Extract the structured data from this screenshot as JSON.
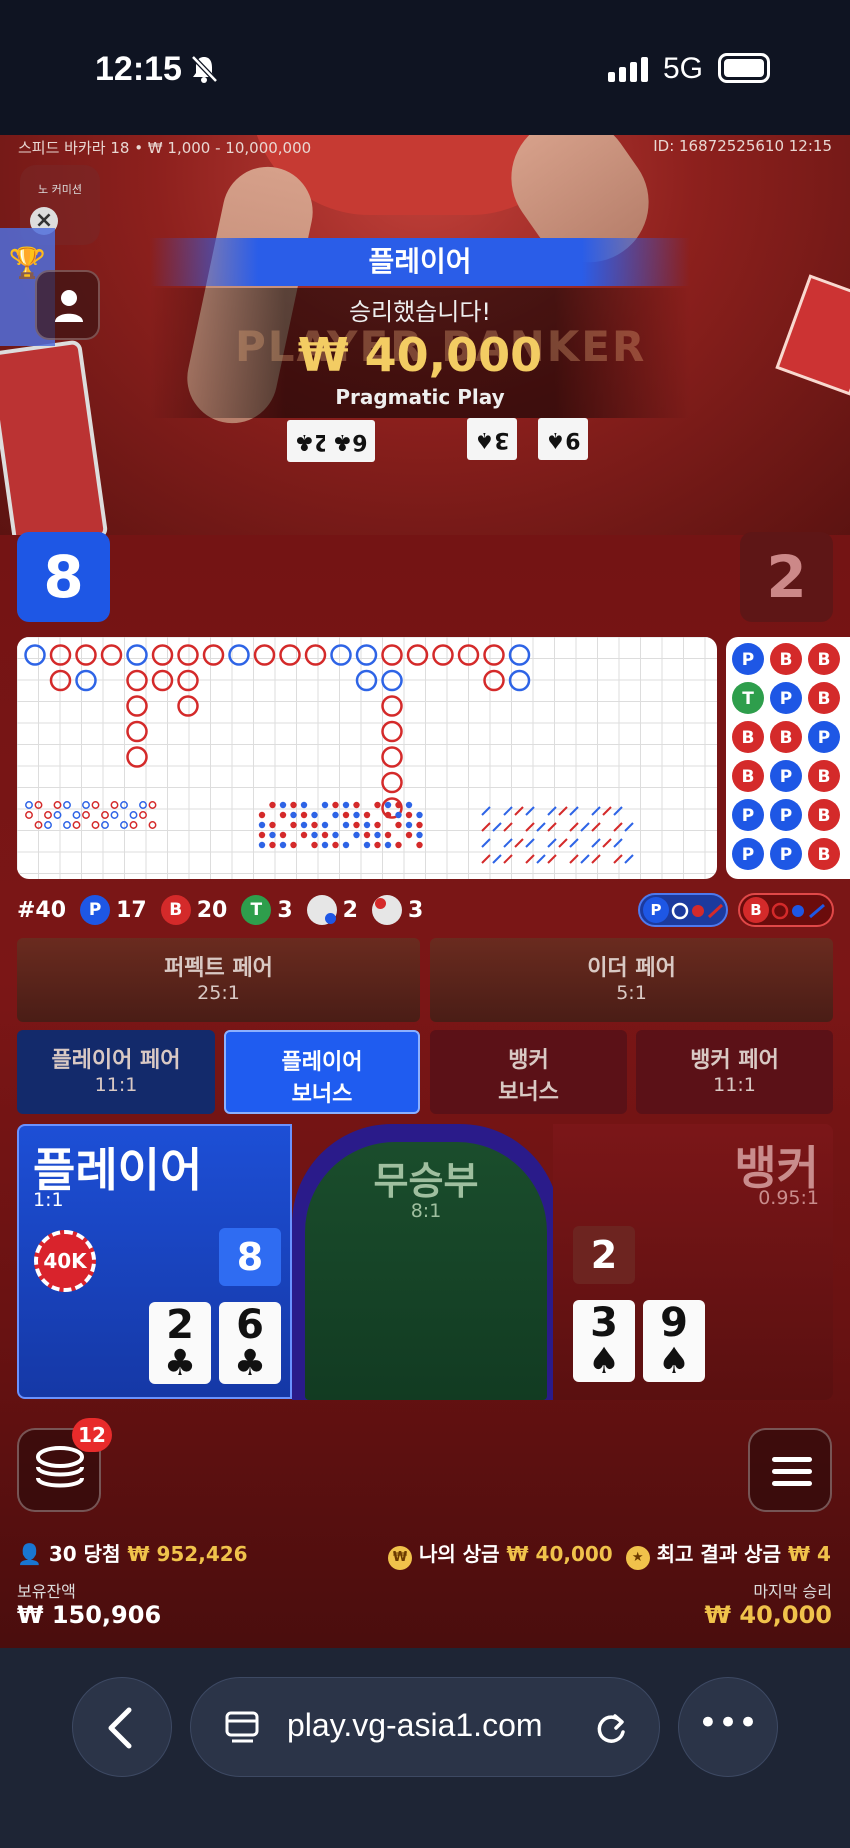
{
  "status": {
    "time": "12:15",
    "network": "5G"
  },
  "table_info": {
    "left": "스피드 바카라 18 • ₩ 1,000 - 10,000,000",
    "right": "ID: 16872525610 12:15",
    "no_commission": "노 커미션"
  },
  "result": {
    "winner": "플레이어",
    "message": "승리했습니다!",
    "amount": "₩ 40,000",
    "provider": "Pragmatic Play",
    "table_print": "PLAYER BANKER"
  },
  "scores": {
    "player": "8",
    "banker": "2"
  },
  "stats": {
    "shoe": "#40",
    "p_label": "P",
    "p_count": "17",
    "b_label": "B",
    "b_count": "20",
    "t_label": "T",
    "t_count": "3",
    "ppair_count": "2",
    "bpair_count": "3",
    "predict_p": "P",
    "predict_b": "B"
  },
  "bets": {
    "perfect_pair": {
      "name": "퍼펙트 페어",
      "odds": "25:1"
    },
    "either_pair": {
      "name": "이더 페어",
      "odds": "5:1"
    },
    "player_pair": {
      "name": "플레이어 페어",
      "odds": "11:1"
    },
    "player_bonus": {
      "line1": "플레이어",
      "line2": "보너스"
    },
    "banker_bonus": {
      "line1": "뱅커",
      "line2": "보너스"
    },
    "banker_pair": {
      "name": "뱅커 페어",
      "odds": "11:1"
    },
    "player": {
      "name": "플레이어",
      "odds": "1:1",
      "chip": "40K",
      "score": "8",
      "cards": [
        {
          "v": "2",
          "s": "♣"
        },
        {
          "v": "6",
          "s": "♣"
        }
      ]
    },
    "tie": {
      "name": "무승부",
      "odds": "8:1"
    },
    "banker": {
      "name": "뱅커",
      "odds": "0.95:1",
      "score": "2",
      "cards": [
        {
          "v": "3",
          "s": "♠"
        },
        {
          "v": "9",
          "s": "♠"
        }
      ]
    }
  },
  "table_cards": {
    "player": [
      {
        "v": "2",
        "s": "♣"
      },
      {
        "v": "6",
        "s": "♣"
      }
    ],
    "banker": [
      {
        "v": "3",
        "s": "♠"
      },
      {
        "v": "9",
        "s": "♠"
      }
    ]
  },
  "footer": {
    "chip_badge": "12",
    "winners_count": "30 당첨",
    "winners_amount": "₩ 952,426",
    "my_win_label": "나의 상금",
    "my_win_amount": "₩ 40,000",
    "best_label": "최고 결과 상금",
    "best_amount": "₩ 4",
    "balance_label": "보유잔액",
    "balance": "₩ 150,906",
    "last_win_label": "마지막 승리",
    "last_win": "₩ 40,000"
  },
  "browser": {
    "url": "play.vg-asia1.com"
  },
  "bead_road": [
    [
      "P",
      "B",
      "B"
    ],
    [
      "T",
      "P",
      "B"
    ],
    [
      "B",
      "B",
      "P"
    ],
    [
      "B",
      "P",
      "B"
    ],
    [
      "P",
      "P",
      "B"
    ],
    [
      "P",
      "P",
      "B"
    ]
  ],
  "colors": {
    "player": "#1e57e5",
    "banker": "#d42a2a",
    "tie": "#2e9e4c",
    "gold": "#f0c24b"
  }
}
